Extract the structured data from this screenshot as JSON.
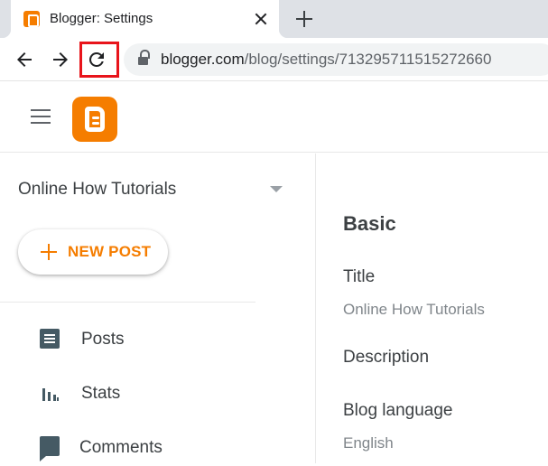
{
  "browser": {
    "tab_title": "Blogger: Settings",
    "url_host": "blogger.com",
    "url_path": "/blog/settings/713295711515272660"
  },
  "sidebar": {
    "blog_name": "Online How Tutorials",
    "new_post_label": "NEW POST",
    "items": [
      {
        "label": "Posts",
        "icon": "posts-icon"
      },
      {
        "label": "Stats",
        "icon": "stats-icon"
      },
      {
        "label": "Comments",
        "icon": "comments-icon"
      }
    ]
  },
  "main": {
    "section_title": "Basic",
    "fields": [
      {
        "label": "Title",
        "value": "Online How Tutorials"
      },
      {
        "label": "Description",
        "value": ""
      },
      {
        "label": "Blog language",
        "value": "English"
      }
    ]
  },
  "colors": {
    "accent": "#f57d00",
    "highlight": "#e8141b"
  }
}
